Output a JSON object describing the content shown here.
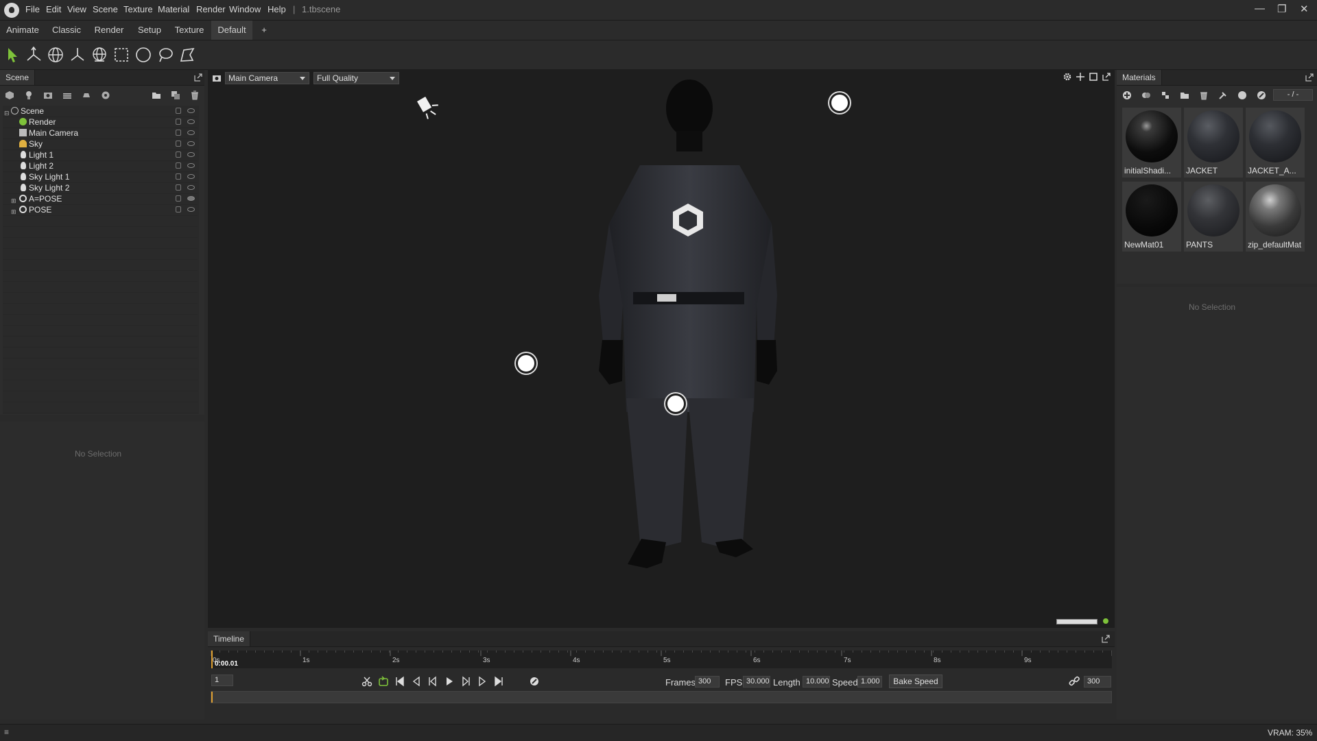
{
  "menubar": {
    "items": [
      "File",
      "Edit",
      "View",
      "Scene",
      "Texture",
      "Material",
      "Render",
      "Window",
      "Help"
    ],
    "separator": "|",
    "filename": "1.tbscene"
  },
  "layouts": {
    "tabs": [
      "Animate",
      "Classic",
      "Render",
      "Setup",
      "Texture",
      "Default"
    ],
    "active": "Default",
    "add_label": "+"
  },
  "scene": {
    "title": "Scene",
    "tree": [
      {
        "label": "Scene"
      },
      {
        "label": "Render"
      },
      {
        "label": "Main Camera"
      },
      {
        "label": "Sky"
      },
      {
        "label": "Light 1"
      },
      {
        "label": "Light 2"
      },
      {
        "label": "Sky Light 1"
      },
      {
        "label": "Sky Light 2"
      },
      {
        "label": "A=POSE"
      },
      {
        "label": "POSE"
      }
    ],
    "no_selection": "No Selection"
  },
  "viewport": {
    "camera": "Main Camera",
    "quality": "Full Quality",
    "accent": "#7ec23a"
  },
  "materials": {
    "title": "Materials",
    "counter": "- / -",
    "items": [
      {
        "name": "initialShadi..."
      },
      {
        "name": "JACKET"
      },
      {
        "name": "JACKET_A..."
      },
      {
        "name": "NewMat01"
      },
      {
        "name": "PANTS"
      },
      {
        "name": "zip_defaultMat"
      }
    ],
    "no_selection": "No Selection"
  },
  "timeline": {
    "title": "Timeline",
    "ticks": [
      "0s",
      "1s",
      "2s",
      "3s",
      "4s",
      "5s",
      "6s",
      "7s",
      "8s",
      "9s"
    ],
    "current_time": "0:00.01",
    "frame": "1",
    "frames_label": "Frames",
    "frames": "300",
    "fps_label": "FPS",
    "fps": "30.000",
    "length_label": "Length",
    "length": "10.000",
    "speed_label": "Speed",
    "speed": "1.000",
    "bake_label": "Bake Speed",
    "end_frame": "300"
  },
  "status": {
    "vram": "VRAM: 35%"
  }
}
